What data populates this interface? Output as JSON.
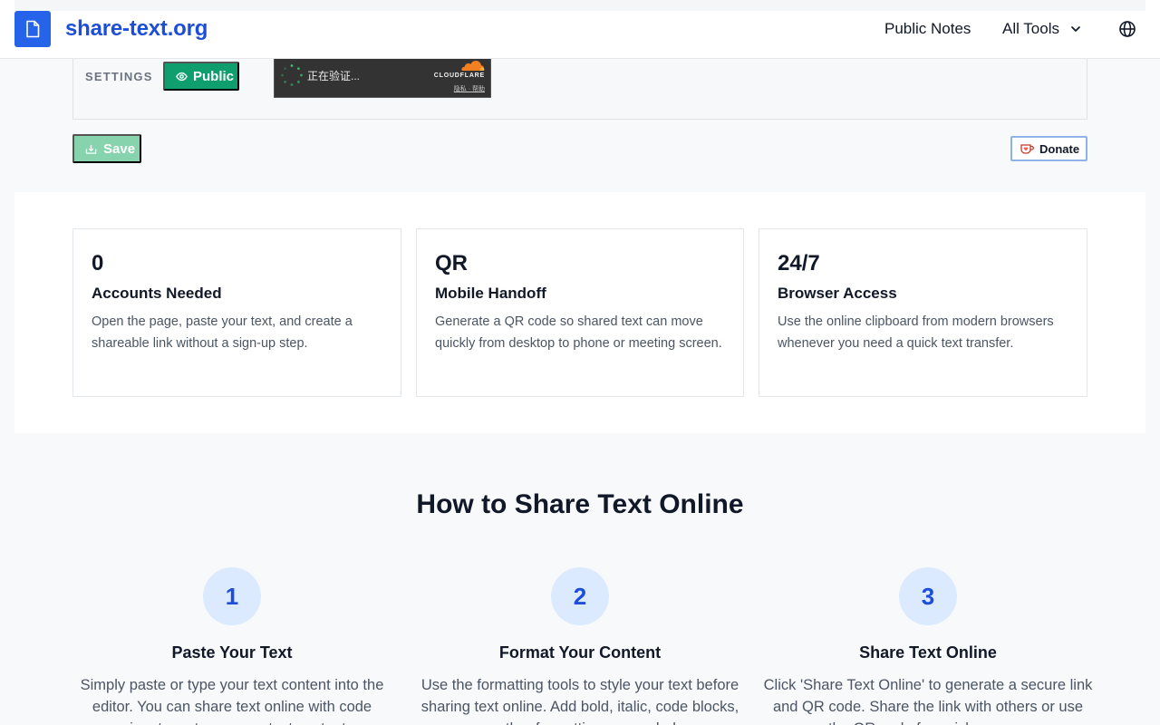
{
  "header": {
    "brand": "share-text.org",
    "nav_public_notes": "Public Notes",
    "nav_all_tools": "All Tools"
  },
  "settings": {
    "label": "SETTINGS",
    "visibility_button": "Public",
    "captcha": {
      "status": "正在验证...",
      "provider": "CLOUDFLARE",
      "links": "隐私 · 帮助"
    }
  },
  "actions": {
    "save_label": "Save",
    "donate_label": "Donate"
  },
  "stats": [
    {
      "value": "0",
      "title": "Accounts Needed",
      "description": "Open the page, paste your text, and create a shareable link without a sign-up step."
    },
    {
      "value": "QR",
      "title": "Mobile Handoff",
      "description": "Generate a QR code so shared text can move quickly from desktop to phone or meeting screen."
    },
    {
      "value": "24/7",
      "title": "Browser Access",
      "description": "Use the online clipboard from modern browsers whenever you need a quick text transfer."
    }
  ],
  "howto": {
    "title": "How to Share Text Online",
    "steps": [
      {
        "number": "1",
        "title": "Paste Your Text",
        "description": "Simply paste or type your text content into the editor. You can share text online with code snippets, notes, or any text content."
      },
      {
        "number": "2",
        "title": "Format Your Content",
        "description": "Use the formatting tools to style your text before sharing text online. Add bold, italic, code blocks, or other formatting as needed."
      },
      {
        "number": "3",
        "title": "Share Text Online",
        "description": "Click 'Share Text Online' to generate a secure link and QR code. Share the link with others or use the QR code for quick access."
      }
    ]
  },
  "colors": {
    "brand": "#2563eb",
    "public_button": "#0f9f6e",
    "save_button_disabled": "#86d3ad",
    "step_circle": "#dbeafe"
  },
  "icons": {
    "logo": "document-icon",
    "all_tools": "chevron-down-icon",
    "language": "globe-icon",
    "public": "eye-icon",
    "save": "download-tray-icon",
    "donate": "kofi-cup-icon"
  }
}
